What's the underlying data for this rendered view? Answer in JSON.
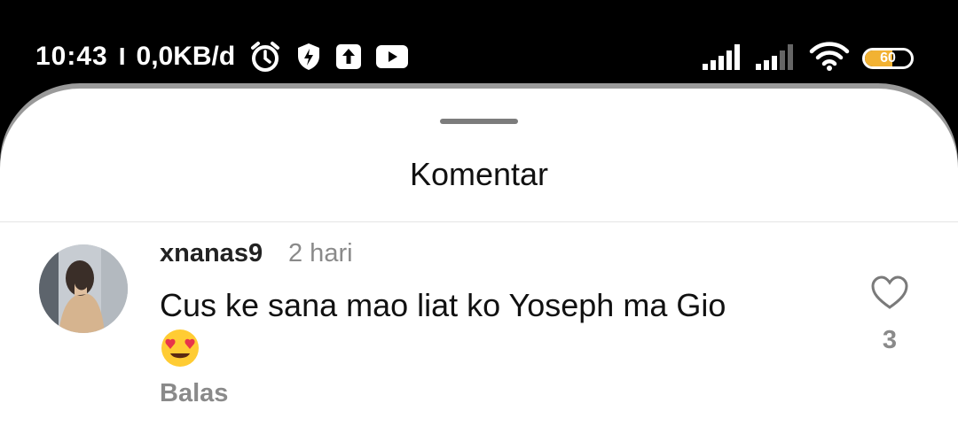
{
  "status_bar": {
    "time": "10:43",
    "separator": "I",
    "net_speed": "0,0KB/d",
    "icons": [
      "alarm-icon",
      "shield-bolt-icon",
      "upload-icon",
      "youtube-icon",
      "signal-icon",
      "signal-icon",
      "wifi-icon",
      "battery-icon"
    ],
    "battery_level": "60",
    "battery_fraction": 0.6,
    "battery_color": "#f2b233"
  },
  "sheet": {
    "title": "Komentar"
  },
  "comment": {
    "username": "xnanas9",
    "time_ago": "2 hari",
    "text": "Cus ke sana mao liat ko Yoseph ma Gio",
    "emoji": "heart-eyes-emoji",
    "reply_label": "Balas",
    "like_icon": "heart-outline-icon",
    "like_count": "3"
  }
}
